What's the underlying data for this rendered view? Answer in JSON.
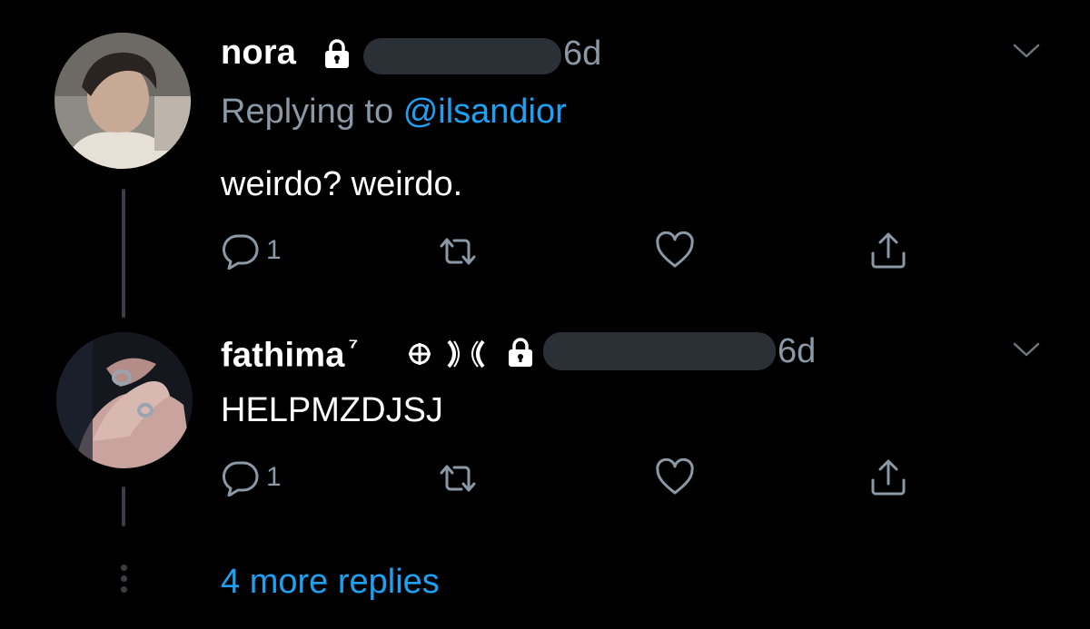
{
  "colors": {
    "background": "#000000",
    "accent": "#1da1f2",
    "secondary_text": "#8b98a5",
    "thread_line": "#3a3f45"
  },
  "tweets": [
    {
      "name": "nora",
      "time": "6d",
      "replying_label": "Replying to",
      "replying_handle": "@ilsandior",
      "text": "weirdo? weirdo.",
      "reply_count": "1",
      "icons": {
        "lock": "lock-icon",
        "menu": "chevron-down-icon",
        "reply": "reply-icon",
        "retweet": "retweet-icon",
        "like": "heart-icon",
        "share": "share-icon"
      }
    },
    {
      "name": "fathima",
      "name_suffix": "⁷",
      "time": "6d",
      "text": "HELPMZDJSJ",
      "reply_count": "1",
      "icons": {
        "badges": "emoji-badges",
        "lock": "lock-icon",
        "menu": "chevron-down-icon",
        "reply": "reply-icon",
        "retweet": "retweet-icon",
        "like": "heart-icon",
        "share": "share-icon"
      }
    }
  ],
  "more_replies_label": "4 more replies"
}
